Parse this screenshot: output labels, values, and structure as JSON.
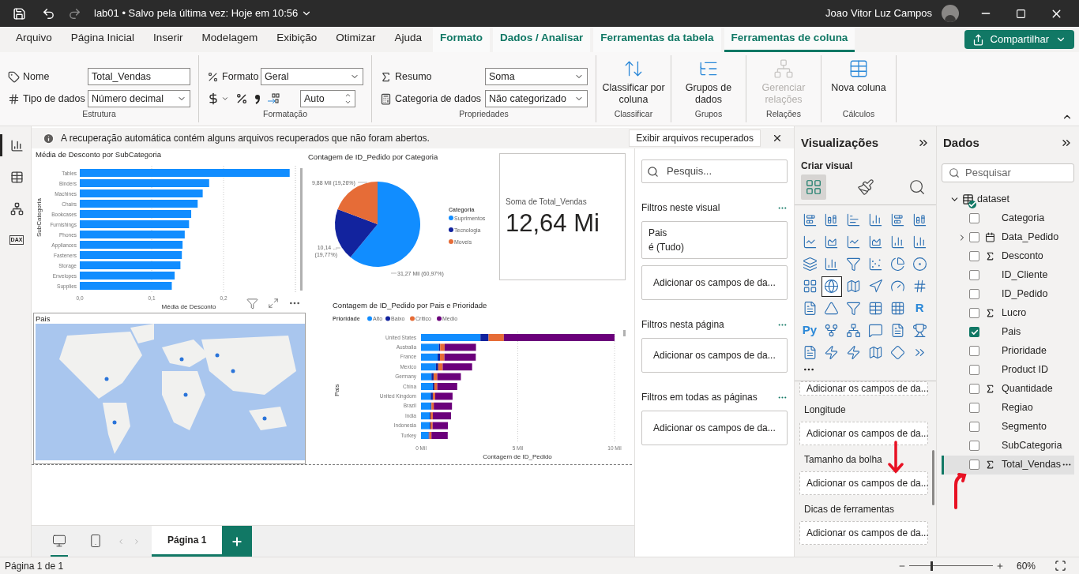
{
  "title_bar": {
    "title": "lab01 • Salvo pela última vez: Hoje em 10:56",
    "user": "Joao Vitor Luz Campos"
  },
  "ribbon": {
    "tabs": [
      {
        "label": "Arquivo",
        "contextual": false,
        "selected": false
      },
      {
        "label": "Página Inicial",
        "contextual": false,
        "selected": false
      },
      {
        "label": "Inserir",
        "contextual": false,
        "selected": false
      },
      {
        "label": "Modelagem",
        "contextual": false,
        "selected": false
      },
      {
        "label": "Exibição",
        "contextual": false,
        "selected": false
      },
      {
        "label": "Otimizar",
        "contextual": false,
        "selected": false
      },
      {
        "label": "Ajuda",
        "contextual": false,
        "selected": false
      },
      {
        "label": "Formato",
        "contextual": true,
        "selected": false
      },
      {
        "label": "Dados / Analisar",
        "contextual": true,
        "selected": false
      },
      {
        "label": "Ferramentas da tabela",
        "contextual": true,
        "selected": false
      },
      {
        "label": "Ferramentas de coluna",
        "contextual": true,
        "selected": true
      }
    ],
    "share_button": "Compartilhar",
    "groups": [
      {
        "kind": "fields",
        "label": "Estrutura",
        "fields": [
          {
            "label": "Nome",
            "value": "Total_Vendas",
            "kind": "text"
          },
          {
            "label": "Tipo de dados",
            "value": "Número decimal",
            "kind": "select"
          }
        ]
      },
      {
        "kind": "format",
        "label": "Formatação",
        "format": {
          "label": "Formato",
          "value": "Geral"
        },
        "decimals": "Auto"
      },
      {
        "kind": "fields",
        "label": "Propriedades",
        "fields": [
          {
            "label": "Resumo",
            "value": "Soma",
            "kind": "select"
          },
          {
            "label": "Categoria de dados",
            "value": "Não categorizado",
            "kind": "select"
          }
        ]
      },
      {
        "kind": "button",
        "label": "Classificar",
        "button": {
          "label": "Classificar por coluna",
          "disabled": false
        }
      },
      {
        "kind": "button",
        "label": "Grupos",
        "button": {
          "label": "Grupos de dados",
          "disabled": false
        }
      },
      {
        "kind": "button",
        "label": "Relações",
        "button": {
          "label": "Gerenciar relações",
          "disabled": true
        }
      },
      {
        "kind": "button",
        "label": "Cálculos",
        "button": {
          "label": "Nova coluna",
          "disabled": false
        }
      }
    ]
  },
  "views": [
    {
      "kind": "report",
      "selected": true
    },
    {
      "kind": "table",
      "selected": false
    },
    {
      "kind": "model",
      "selected": false
    },
    {
      "kind": "dax",
      "label": "DAX",
      "selected": false
    }
  ],
  "info_bar": {
    "message": "A recuperação automática contém alguns arquivos recuperados que não foram abertos.",
    "button": "Exibir arquivos recuperados"
  },
  "visuals": [
    {
      "kind": "bar",
      "chart_data": {
        "type": "bar",
        "orientation": "horizontal",
        "title": "Média de Desconto por SubCategoria",
        "xlabel": "Média de Desconto",
        "ylabel": "SubCategoria",
        "categories": [
          "Tables",
          "Binders",
          "Machines",
          "Chairs",
          "Bookcases",
          "Furnishings",
          "Phones",
          "Appliances",
          "Fasteners",
          "Storage",
          "Envelopes",
          "Supplies"
        ],
        "values": [
          0.292,
          0.18,
          0.171,
          0.164,
          0.155,
          0.152,
          0.146,
          0.143,
          0.142,
          0.14,
          0.132,
          0.128
        ],
        "xlim": [
          0,
          0.3
        ],
        "xticks": [
          {
            "value": 0,
            "label": "0,0"
          },
          {
            "value": 0.1,
            "label": "0,1"
          },
          {
            "value": 0.2,
            "label": "0,2"
          }
        ]
      }
    },
    {
      "kind": "pie",
      "chart_data": {
        "type": "pie",
        "title": "Contagem de ID_Pedido por Categoria",
        "legend": "right",
        "legend_title": "Categoria",
        "categories": [
          "Suprimentos",
          "Tecnologia",
          "Moveis"
        ],
        "values": [
          60.97,
          19.77,
          19.26
        ],
        "colors": [
          "#118dff",
          "#12239e",
          "#e66c37"
        ],
        "value_labels": [
          "31,27 Mil (60,97%)",
          "10,14 ... (19,77%)",
          "9,88 Mil (19,26%)"
        ]
      }
    },
    {
      "kind": "card",
      "label": "Soma de Total_Vendas",
      "value": "12,64 Mi"
    },
    {
      "kind": "map",
      "title": "Pais",
      "selected": true
    },
    {
      "kind": "stacked_bar",
      "chart_data": {
        "type": "bar",
        "orientation": "horizontal",
        "stacked": true,
        "title": "Contagem de ID_Pedido por Pais e Prioridade",
        "legend": "top",
        "legend_title": "Prioridade",
        "xlim": [
          0,
          10
        ],
        "xlabel": "Contagem de ID_Pedido",
        "ylabel": "Pais",
        "categories": [
          "United States",
          "Australia",
          "France",
          "Mexico",
          "Germany",
          "China",
          "United Kingdom",
          "Brazil",
          "India",
          "Indonesia",
          "Turkey"
        ],
        "series": [
          {
            "name": "Alto",
            "color": "#118dff",
            "values": [
              3.07,
              0.92,
              0.86,
              0.77,
              0.54,
              0.61,
              0.5,
              0.5,
              0.45,
              0.45,
              0.39
            ]
          },
          {
            "name": "Baixo",
            "color": "#12239e",
            "values": [
              0.42,
              0.07,
              0.12,
              0.12,
              0.11,
              0.08,
              0.11,
              0.04,
              0.04,
              0.04,
              0.04
            ]
          },
          {
            "name": "Critico",
            "color": "#e66c37",
            "values": [
              0.79,
              0.23,
              0.23,
              0.23,
              0.19,
              0.15,
              0.12,
              0.12,
              0.12,
              0.11,
              0.11
            ]
          },
          {
            "name": "Medio",
            "color": "#6b007b",
            "values": [
              5.72,
              1.62,
              1.62,
              1.52,
              1.22,
              1.03,
              0.9,
              0.94,
              0.94,
              0.79,
              0.84
            ]
          }
        ],
        "xticks": [
          {
            "value": 0,
            "label": "0 Mil"
          },
          {
            "value": 5,
            "label": "5 Mil"
          },
          {
            "value": 10,
            "label": "10 Mil"
          }
        ]
      }
    }
  ],
  "filters": {
    "search_placeholder": "Pesquis...",
    "sections": [
      {
        "title": "Filtros neste visual",
        "cards": [
          {
            "field": "Pais",
            "condition": "é (Tudo)"
          }
        ],
        "drop_hint": "Adicionar os campos de da..."
      },
      {
        "title": "Filtros nesta página",
        "drop_hint": "Adicionar os campos de da..."
      },
      {
        "title": "Filtros em todas as páginas",
        "drop_hint": "Adicionar os campos de da..."
      }
    ]
  },
  "pages": {
    "device_views": [
      {
        "kind": "desktop",
        "selected": true
      },
      {
        "kind": "phone",
        "selected": false
      }
    ],
    "tabs": [
      {
        "label": "Página 1",
        "selected": true
      }
    ]
  },
  "visualizations": {
    "title": "Visualizações",
    "subtitle": "Criar visual",
    "modes": [
      {
        "kind": "build",
        "selected": true
      },
      {
        "kind": "format",
        "selected": false
      },
      {
        "kind": "analytics",
        "selected": false
      }
    ],
    "types": [
      {
        "selected": false
      },
      {
        "selected": false
      },
      {
        "selected": false
      },
      {
        "selected": false
      },
      {
        "selected": false
      },
      {
        "selected": false
      },
      {
        "selected": false
      },
      {
        "selected": false
      },
      {
        "selected": false
      },
      {
        "selected": false
      },
      {
        "selected": false
      },
      {
        "selected": false
      },
      {
        "selected": false
      },
      {
        "selected": false
      },
      {
        "selected": false
      },
      {
        "selected": false
      },
      {
        "selected": false
      },
      {
        "selected": false
      },
      {
        "selected": false
      },
      {
        "selected": true
      },
      {
        "selected": false
      },
      {
        "selected": false
      },
      {
        "selected": false
      },
      {
        "selected": false
      },
      {
        "selected": false
      },
      {
        "selected": false
      },
      {
        "selected": false
      },
      {
        "selected": false
      },
      {
        "selected": false
      },
      {
        "selected": false,
        "label": "R"
      },
      {
        "selected": false,
        "label": "Py"
      },
      {
        "selected": false
      },
      {
        "selected": false
      },
      {
        "selected": false
      },
      {
        "selected": false
      },
      {
        "selected": false
      },
      {
        "selected": false
      },
      {
        "selected": false
      },
      {
        "selected": false
      },
      {
        "selected": false
      },
      {
        "selected": false
      },
      {
        "selected": false
      }
    ],
    "wells": [
      {
        "hint": "Adicionar os campos de da..."
      },
      {
        "title": "Longitude",
        "hint": "Adicionar os campos de da..."
      },
      {
        "title": "Tamanho da bolha",
        "hint": "Adicionar os campos de da..."
      },
      {
        "title": "Dicas de ferramentas",
        "hint": "Adicionar os campos de da..."
      }
    ]
  },
  "data_pane": {
    "title": "Dados",
    "search_placeholder": "Pesquisar",
    "table": {
      "name": "dataset",
      "expanded": true,
      "children": [
        {
          "name": "Categoria",
          "kind": "text",
          "checked": false,
          "selected": false
        },
        {
          "name": "Data_Pedido",
          "kind": "date",
          "checked": false,
          "selected": false,
          "expanded": false
        },
        {
          "name": "Desconto",
          "kind": "measure",
          "checked": false,
          "selected": false
        },
        {
          "name": "ID_Cliente",
          "kind": "text",
          "checked": false,
          "selected": false
        },
        {
          "name": "ID_Pedido",
          "kind": "text",
          "checked": false,
          "selected": false
        },
        {
          "name": "Lucro",
          "kind": "measure",
          "checked": false,
          "selected": false
        },
        {
          "name": "Pais",
          "kind": "text",
          "checked": true,
          "selected": false
        },
        {
          "name": "Prioridade",
          "kind": "text",
          "checked": false,
          "selected": false
        },
        {
          "name": "Product ID",
          "kind": "text",
          "checked": false,
          "selected": false
        },
        {
          "name": "Quantidade",
          "kind": "measure",
          "checked": false,
          "selected": false
        },
        {
          "name": "Regiao",
          "kind": "text",
          "checked": false,
          "selected": false
        },
        {
          "name": "Segmento",
          "kind": "text",
          "checked": false,
          "selected": false
        },
        {
          "name": "SubCategoria",
          "kind": "text",
          "checked": false,
          "selected": false
        },
        {
          "name": "Total_Vendas",
          "kind": "measure",
          "checked": false,
          "selected": true
        }
      ]
    }
  },
  "status_bar": {
    "page": "Página 1 de 1",
    "zoom": "60%",
    "level": 0.25
  }
}
